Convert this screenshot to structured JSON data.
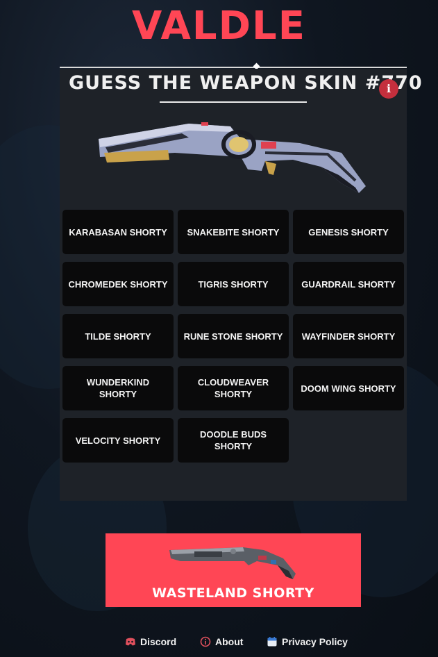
{
  "logo": {
    "text": "VALDLE",
    "color": "#ff4655"
  },
  "header": {
    "title": "GUESS THE WEAPON SKIN #770",
    "info_icon": "i"
  },
  "options": [
    "KARABASAN SHORTY",
    "SNAKEBITE SHORTY",
    "GENESIS SHORTY",
    "CHROMEDEK SHORTY",
    "TIGRIS SHORTY",
    "GUARDRAIL SHORTY",
    "TILDE SHORTY",
    "RUNE STONE SHORTY",
    "WAYFINDER SHORTY",
    "WUNDERKIND SHORTY",
    "CLOUDWEAVER SHORTY",
    "DOOM WING SHORTY",
    "VELOCITY SHORTY",
    "DOODLE BUDS SHORTY"
  ],
  "answer": {
    "name": "WASTELAND SHORTY"
  },
  "footer": {
    "discord": "Discord",
    "about": "About",
    "privacy": "Privacy Policy"
  },
  "colors": {
    "accent": "#ff4655",
    "panel": "#1e2228",
    "option_bg": "#0a0a0b"
  }
}
